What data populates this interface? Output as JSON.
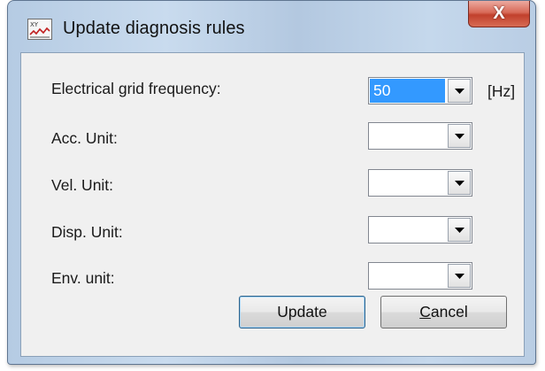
{
  "window": {
    "title": "Update diagnosis rules",
    "close_label": "X",
    "icon": "diagnosis-chart-icon"
  },
  "form": {
    "rows": [
      {
        "label": "Electrical grid frequency:",
        "value": "50",
        "unit": "[Hz]"
      },
      {
        "label": "Acc. Unit:",
        "value": ""
      },
      {
        "label": "Vel. Unit:",
        "value": ""
      },
      {
        "label": "Disp. Unit:",
        "value": ""
      },
      {
        "label": "Env. unit:",
        "value": ""
      }
    ]
  },
  "buttons": {
    "update_label": "Update",
    "cancel_prefix": "C",
    "cancel_rest": "ancel"
  },
  "colors": {
    "selection": "#3399ff",
    "close_button": "#c1402c",
    "frame": "#b5cbe3"
  }
}
